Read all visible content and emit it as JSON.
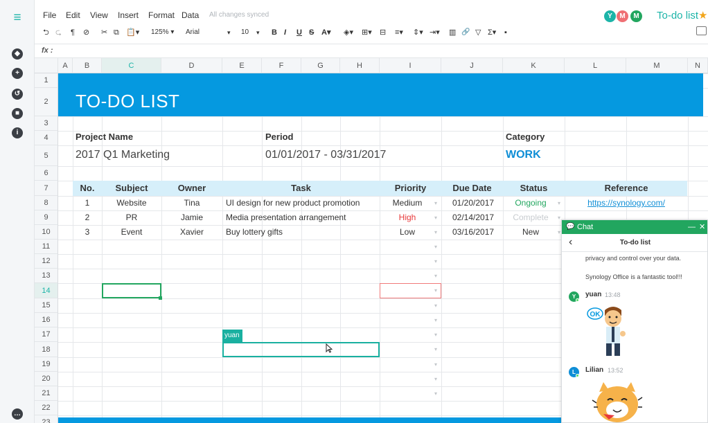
{
  "topbar": {
    "menus": [
      "File",
      "Edit",
      "View",
      "Insert",
      "Format",
      "Data"
    ],
    "sync_status": "All changes synced",
    "collaborators": [
      {
        "initial": "Y",
        "color": "#1cb4a8"
      },
      {
        "initial": "M",
        "color": "#ef6f74"
      },
      {
        "initial": "M",
        "color": "#22a65f"
      }
    ],
    "doc_title": "To-do list",
    "star_icon": "★"
  },
  "toolbar": {
    "undo": "⮌",
    "redo": "⮎",
    "paint_format": "¶",
    "clear_format": "⊘",
    "cut": "✂",
    "copy": "⧉",
    "paste": "📋▾",
    "zoom": "125% ▾",
    "font": "Arial",
    "font_caret": "▾",
    "font_size": "10",
    "font_size_caret": "▾",
    "bold": "B",
    "italic": "I",
    "underline": "U",
    "strike": "S",
    "text_color": "A▾",
    "fill_color": "◈▾",
    "borders": "⊞▾",
    "merge": "⊟",
    "h_align": "≡▾",
    "v_align": "⇕▾",
    "wrap": "⇥▾",
    "chart": "▥",
    "link": "🔗",
    "filter": "▽",
    "sum": "Σ▾",
    "comment": "▪"
  },
  "formula_bar": {
    "fx": "fx :",
    "value": ""
  },
  "columns": [
    "A",
    "B",
    "C",
    "D",
    "E",
    "F",
    "G",
    "H",
    "I",
    "J",
    "K",
    "L",
    "M",
    "N"
  ],
  "rows": [
    "1",
    "2",
    "3",
    "4",
    "5",
    "6",
    "7",
    "8",
    "9",
    "10",
    "11",
    "12",
    "13",
    "14",
    "15",
    "16",
    "17",
    "18",
    "19",
    "20",
    "21",
    "22",
    "23"
  ],
  "sheet": {
    "title": "TO-DO LIST",
    "project_name_label": "Project Name",
    "project_name": "2017 Q1 Marketing",
    "period_label": "Period",
    "period": "01/01/2017 - 03/31/2017",
    "category_label": "Category",
    "category": "WORK",
    "headers": [
      "No.",
      "Subject",
      "Owner",
      "Task",
      "Priority",
      "Due Date",
      "Status",
      "Reference"
    ],
    "tasks": [
      {
        "no": "1",
        "subject": "Website",
        "owner": "Tina",
        "task": "UI design for new product promotion",
        "priority": "Medium",
        "due": "01/20/2017",
        "status": "Ongoing",
        "reference": "https://synology.com/"
      },
      {
        "no": "2",
        "subject": "PR",
        "owner": "Jamie",
        "task": "Media presentation arrangement",
        "priority": "High",
        "due": "02/14/2017",
        "status": "Complete",
        "reference": ""
      },
      {
        "no": "3",
        "subject": "Event",
        "owner": "Xavier",
        "task": "Buy lottery gifts",
        "priority": "Low",
        "due": "03/16/2017",
        "status": "New",
        "reference": ""
      }
    ],
    "cursor_tag": "yuan"
  },
  "colors": {
    "accent": "#1cb4a8",
    "title_band": "#0599e0",
    "header_band": "#d6effa",
    "priority_high": "#e8393a",
    "status_ongoing": "#22a65f",
    "status_complete": "#c8ccd0",
    "link": "#0f8ed6"
  },
  "chat": {
    "header": "Chat",
    "title": "To-do list",
    "minimize": "—",
    "close": "✕",
    "back": "‹",
    "messages_text": [
      "privacy and control over your data.",
      "Synology Office is a fantastic tool!!!"
    ],
    "users": [
      {
        "initial": "Y",
        "name": "yuan",
        "time": "13:48",
        "color": "#22a65f",
        "sticker": "OK"
      },
      {
        "initial": "L",
        "name": "Lilian",
        "time": "13:52",
        "color": "#0f8ed6",
        "sticker": ""
      }
    ]
  }
}
